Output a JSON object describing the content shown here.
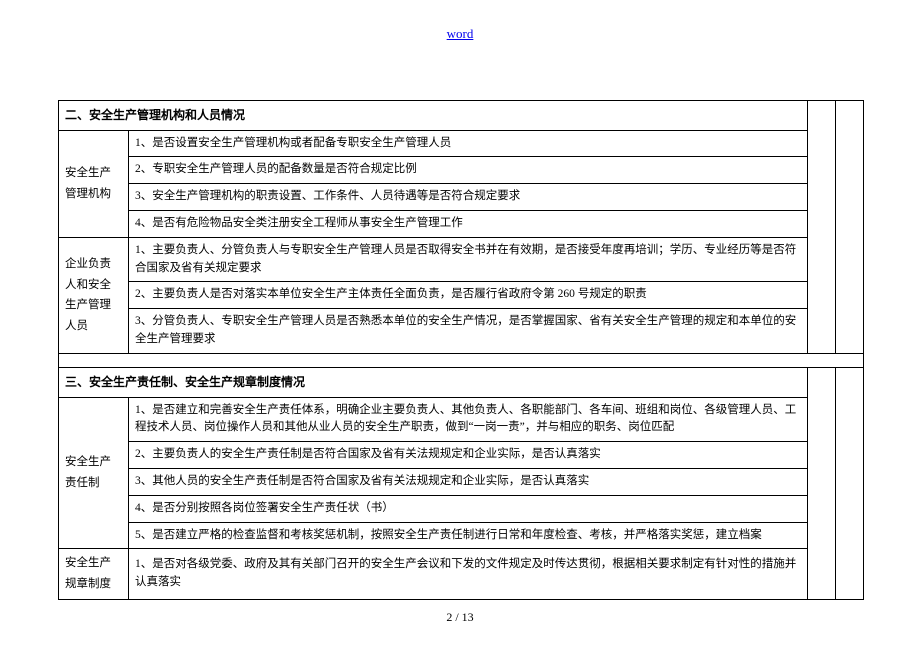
{
  "header": {
    "link_text": "word"
  },
  "footer": {
    "page_current": "2",
    "page_sep": " / ",
    "page_total": "13"
  },
  "sec2": {
    "title": "二、安全生产管理机构和人员情况",
    "group1": {
      "label": "安全生产管理机构",
      "rows": [
        "1、是否设置安全生产管理机构或者配备专职安全生产管理人员",
        "2、专职安全生产管理人员的配备数量是否符合规定比例",
        "3、安全生产管理机构的职责设置、工作条件、人员待遇等是否符合规定要求",
        "4、是否有危险物品安全类注册安全工程师从事安全生产管理工作"
      ]
    },
    "group2": {
      "label": "企业负责人和安全生产管理人员",
      "rows": [
        "1、主要负责人、分管负责人与专职安全生产管理人员是否取得安全书并在有效期，是否接受年度再培训；学历、专业经历等是否符合国家及省有关规定要求",
        "2、主要负责人是否对落实本单位安全生产主体责任全面负责，是否履行省政府令第 260 号规定的职责",
        "3、分管负责人、专职安全生产管理人员是否熟悉本单位的安全生产情况，是否掌握国家、省有关安全生产管理的规定和本单位的安全生产管理要求"
      ]
    }
  },
  "sec3": {
    "title": "三、安全生产责任制、安全生产规章制度情况",
    "group1": {
      "label": "安全生产责任制",
      "rows": [
        "1、是否建立和完善安全生产责任体系，明确企业主要负责人、其他负责人、各职能部门、各车间、班组和岗位、各级管理人员、工程技术人员、岗位操作人员和其他从业人员的安全生产职责，做到“一岗一责”，并与相应的职务、岗位匹配",
        "2、主要负责人的安全生产责任制是否符合国家及省有关法规规定和企业实际，是否认真落实",
        "3、其他人员的安全生产责任制是否符合国家及省有关法规规定和企业实际，是否认真落实",
        "4、是否分别按照各岗位签署安全生产责任状（书）",
        "5、是否建立严格的检查监督和考核奖惩机制，按照安全生产责任制进行日常和年度检查、考核，并严格落实奖惩，建立档案"
      ]
    },
    "group2": {
      "label": "安全生产规章制度",
      "rows": [
        "1、是否对各级党委、政府及其有关部门召开的安全生产会议和下发的文件规定及时传达贯彻，根据相关要求制定有针对性的措施并认真落实"
      ]
    }
  }
}
